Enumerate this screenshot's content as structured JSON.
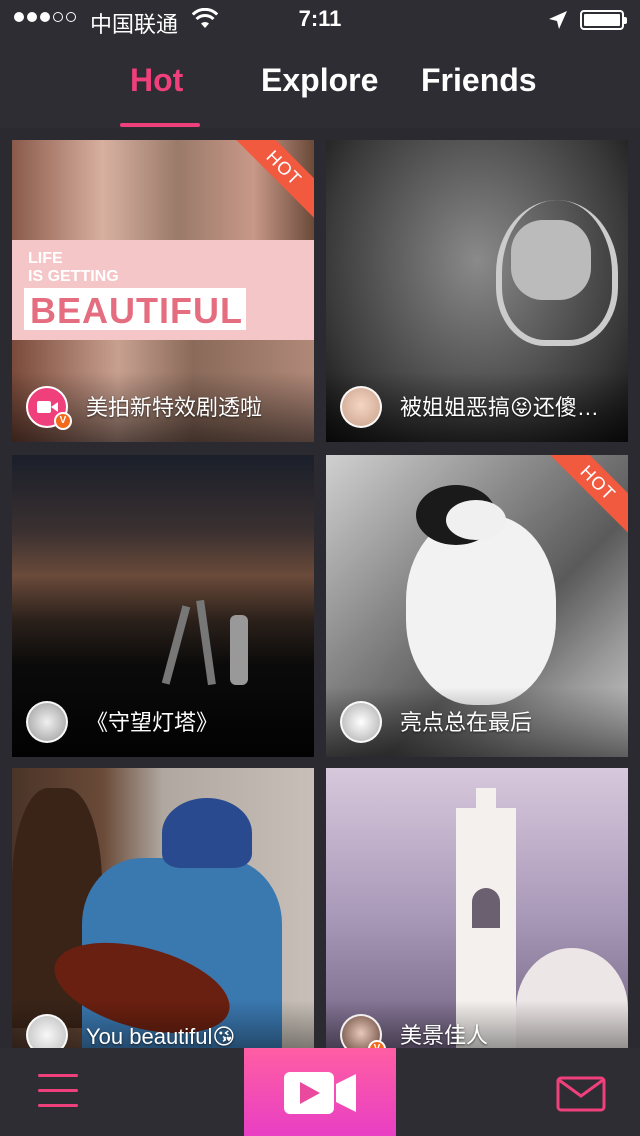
{
  "status_bar": {
    "carrier": "中国联通",
    "time": "7:11"
  },
  "tabs": [
    {
      "label": "Hot",
      "active": true
    },
    {
      "label": "Explore",
      "active": false
    },
    {
      "label": "Friends",
      "active": false
    }
  ],
  "feed": [
    {
      "caption": "美拍新特效剧透啦",
      "hot": true,
      "hot_label": "HOT",
      "verified": true,
      "verified_label": "V",
      "poster_text_1": "LIFE",
      "poster_text_2": "IS GETTING",
      "poster_text_3": "BEAUTIFUL"
    },
    {
      "caption": "被姐姐恶搞😝还傻…",
      "hot": false
    },
    {
      "caption": "《守望灯塔》",
      "hot": false
    },
    {
      "caption": "亮点总在最后",
      "hot": true,
      "hot_label": "HOT"
    },
    {
      "caption": "You beautiful😘",
      "hot": false
    },
    {
      "caption": "美景佳人",
      "hot": false,
      "verified": true,
      "verified_label": "V"
    }
  ],
  "bottom_bar": {
    "menu_icon": "hamburger-menu-icon",
    "record_icon": "video-camera-icon",
    "messages_icon": "envelope-icon"
  },
  "colors": {
    "accent": "#f0407c",
    "hot_ribbon": "#f15a3e",
    "background": "#2a2a30"
  }
}
